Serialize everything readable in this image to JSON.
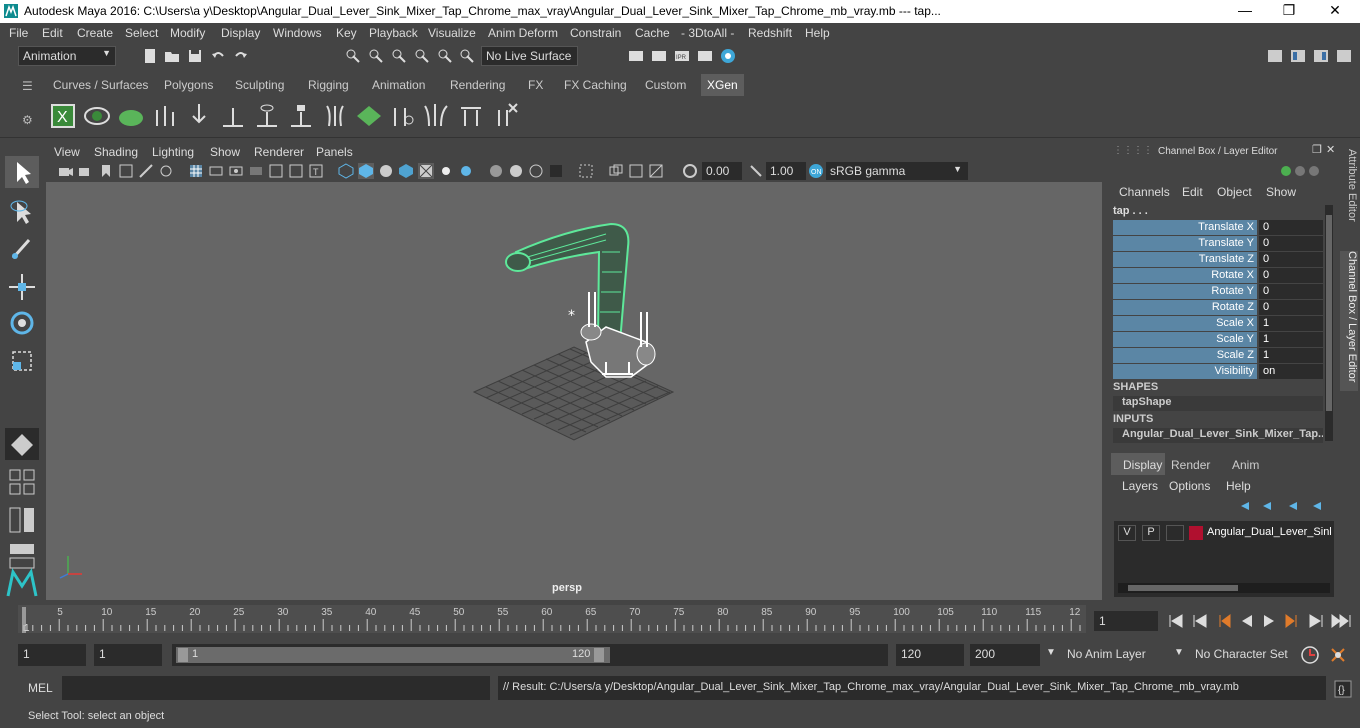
{
  "window": {
    "title": "Autodesk Maya 2016: C:\\Users\\a y\\Desktop\\Angular_Dual_Lever_Sink_Mixer_Tap_Chrome_max_vray\\Angular_Dual_Lever_Sink_Mixer_Tap_Chrome_mb_vray.mb    ---    tap...",
    "minimize": "—",
    "maximize": "❐",
    "close": "✕"
  },
  "menu": [
    "File",
    "Edit",
    "Create",
    "Select",
    "Modify",
    "Display",
    "Windows",
    "Key",
    "Playback",
    "Visualize",
    "Anim Deform",
    "Constrain",
    "Cache",
    "- 3DtoAll -",
    "Redshift",
    "Help"
  ],
  "status": {
    "mode": "Animation",
    "live_surface": "No Live Surface"
  },
  "shelf_tabs": [
    "Curves / Surfaces",
    "Polygons",
    "Sculpting",
    "Rigging",
    "Animation",
    "Rendering",
    "FX",
    "FX Caching",
    "Custom",
    "XGen"
  ],
  "shelf_active": "XGen",
  "viewport_menu": [
    "View",
    "Shading",
    "Lighting",
    "Show",
    "Renderer",
    "Panels"
  ],
  "viewport": {
    "exposure": "0.00",
    "gamma": "1.00",
    "colorspace": "sRGB gamma",
    "camera": "persp"
  },
  "channel_box": {
    "title": "Channel Box / Layer Editor",
    "menu": [
      "Channels",
      "Edit",
      "Object",
      "Show"
    ],
    "object": "tap . . .",
    "attributes": [
      {
        "name": "Translate X",
        "value": "0"
      },
      {
        "name": "Translate Y",
        "value": "0"
      },
      {
        "name": "Translate Z",
        "value": "0"
      },
      {
        "name": "Rotate X",
        "value": "0"
      },
      {
        "name": "Rotate Y",
        "value": "0"
      },
      {
        "name": "Rotate Z",
        "value": "0"
      },
      {
        "name": "Scale X",
        "value": "1"
      },
      {
        "name": "Scale Y",
        "value": "1"
      },
      {
        "name": "Scale Z",
        "value": "1"
      },
      {
        "name": "Visibility",
        "value": "on"
      }
    ],
    "shapes_header": "SHAPES",
    "shape": "tapShape",
    "inputs_header": "INPUTS",
    "input": "Angular_Dual_Lever_Sink_Mixer_Tap..."
  },
  "side_tabs": [
    "Attribute Editor",
    "Channel Box / Layer Editor"
  ],
  "layer_editor": {
    "tabs": [
      "Display",
      "Render",
      "Anim"
    ],
    "menu": [
      "Layers",
      "Options",
      "Help"
    ],
    "layer": {
      "v": "V",
      "p": "P",
      "name": "Angular_Dual_Lever_Sink"
    }
  },
  "timeline": {
    "ticks": [
      "5",
      "10",
      "15",
      "20",
      "25",
      "30",
      "35",
      "40",
      "45",
      "50",
      "55",
      "60",
      "65",
      "70",
      "75",
      "80",
      "85",
      "90",
      "95",
      "100",
      "105",
      "110",
      "115",
      "12"
    ],
    "start_label": "1",
    "current_frame": "1"
  },
  "range": {
    "start": "1",
    "inner_start": "1",
    "slider_start": "1",
    "slider_end": "120",
    "end": "120",
    "max": "200",
    "anim_layer": "No Anim Layer",
    "char_set": "No Character Set"
  },
  "mel": {
    "label": "MEL",
    "result": "// Result: C:/Users/a y/Desktop/Angular_Dual_Lever_Sink_Mixer_Tap_Chrome_max_vray/Angular_Dual_Lever_Sink_Mixer_Tap_Chrome_mb_vray.mb"
  },
  "help": "Select Tool: select an object",
  "colors": {
    "accent": "#5b86a5",
    "selected_wire": "#5ee89a",
    "layer_color": "#b0102f"
  }
}
